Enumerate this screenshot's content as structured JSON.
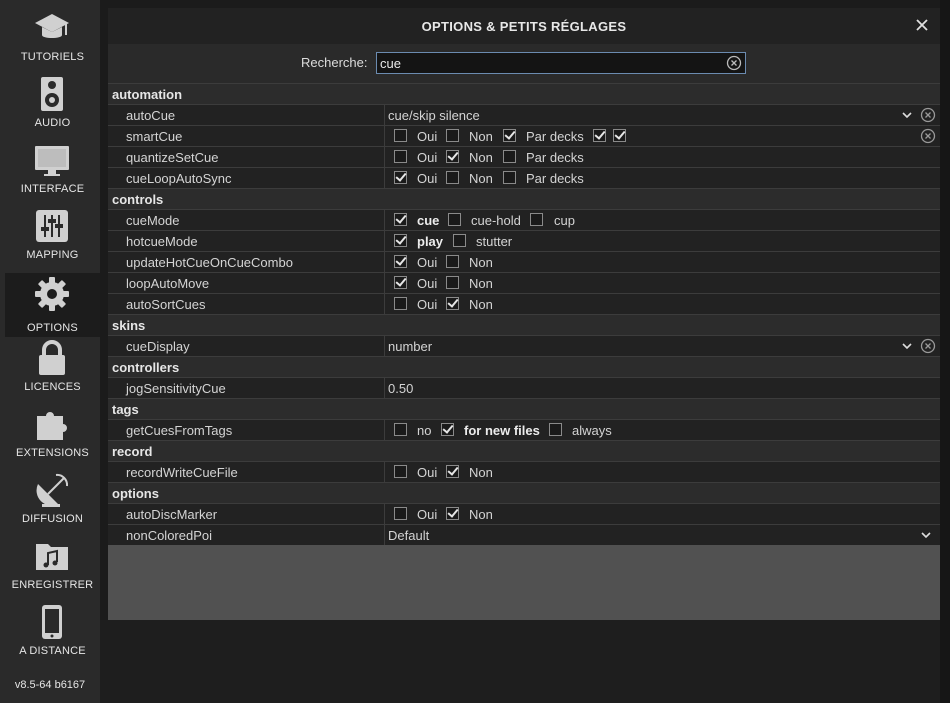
{
  "sidebar": {
    "items": [
      {
        "id": "tutoriels",
        "label": "TUTORIELS",
        "icon": "graduation-cap-icon",
        "active": false
      },
      {
        "id": "audio",
        "label": "AUDIO",
        "icon": "speaker-icon",
        "active": false
      },
      {
        "id": "interface",
        "label": "INTERFACE",
        "icon": "monitor-icon",
        "active": false
      },
      {
        "id": "mapping",
        "label": "MAPPING",
        "icon": "sliders-icon",
        "active": false
      },
      {
        "id": "options",
        "label": "OPTIONS",
        "icon": "gear-icon",
        "active": true
      },
      {
        "id": "licences",
        "label": "LICENCES",
        "icon": "lock-icon",
        "active": false
      },
      {
        "id": "extensions",
        "label": "EXTENSIONS",
        "icon": "puzzle-icon",
        "active": false
      },
      {
        "id": "diffusion",
        "label": "DIFFUSION",
        "icon": "satellite-dish-icon",
        "active": false
      },
      {
        "id": "enregistrer",
        "label": "ENREGISTRER",
        "icon": "music-folder-icon",
        "active": false
      },
      {
        "id": "a-distance",
        "label": "A DISTANCE",
        "icon": "phone-icon",
        "active": false
      }
    ],
    "version": "v8.5-64 b6167"
  },
  "dialog": {
    "title": "OPTIONS & PETITS RÉGLAGES",
    "close_icon": "close-icon"
  },
  "search": {
    "label": "Recherche:",
    "value": "cue",
    "clear_icon": "clear-circle-icon"
  },
  "labels": {
    "oui": "Oui",
    "non": "Non",
    "par_decks": "Par decks"
  },
  "sections": {
    "automation": "automation",
    "controls": "controls",
    "skins": "skins",
    "controllers": "controllers",
    "tags": "tags",
    "record": "record",
    "options": "options"
  },
  "rows": {
    "autoCue": {
      "name": "autoCue",
      "value": "cue/skip silence"
    },
    "smartCue": {
      "name": "smartCue",
      "oui": false,
      "non": false,
      "par_decks": true,
      "deck1": true,
      "deck2": true
    },
    "quantizeSetCue": {
      "name": "quantizeSetCue",
      "oui": false,
      "non": true,
      "par_decks": false
    },
    "cueLoopAutoSync": {
      "name": "cueLoopAutoSync",
      "oui": true,
      "non": false,
      "par_decks": false
    },
    "cueMode": {
      "name": "cueMode",
      "options": [
        "cue",
        "cue-hold",
        "cup"
      ],
      "selected": "cue"
    },
    "hotcueMode": {
      "name": "hotcueMode",
      "options": [
        "play",
        "stutter"
      ],
      "selected": "play"
    },
    "updateHotCueOnCueCombo": {
      "name": "updateHotCueOnCueCombo",
      "oui": true,
      "non": false
    },
    "loopAutoMove": {
      "name": "loopAutoMove",
      "oui": true,
      "non": false
    },
    "autoSortCues": {
      "name": "autoSortCues",
      "oui": false,
      "non": true
    },
    "cueDisplay": {
      "name": "cueDisplay",
      "value": "number"
    },
    "jogSensitivityCue": {
      "name": "jogSensitivityCue",
      "value": "0.50"
    },
    "getCuesFromTags": {
      "name": "getCuesFromTags",
      "options": [
        "no",
        "for new files",
        "always"
      ],
      "selected": "for new files"
    },
    "recordWriteCueFile": {
      "name": "recordWriteCueFile",
      "oui": false,
      "non": true
    },
    "autoDiscMarker": {
      "name": "autoDiscMarker",
      "oui": false,
      "non": true
    },
    "nonColoredPoi": {
      "name": "nonColoredPoi",
      "value": "Default"
    }
  }
}
